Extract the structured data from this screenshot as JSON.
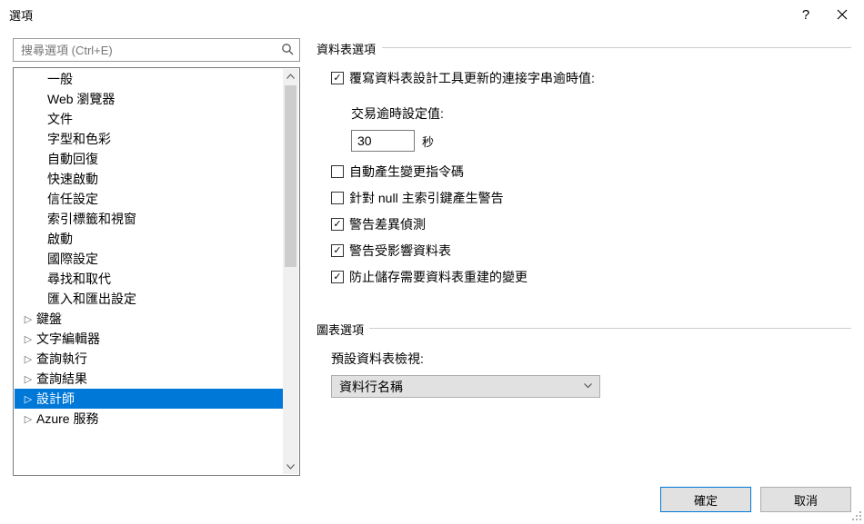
{
  "title": "選項",
  "search_placeholder": "搜尋選項 (Ctrl+E)",
  "tree": {
    "items": [
      {
        "label": "一般",
        "lv": 2
      },
      {
        "label": "Web 瀏覽器",
        "lv": 2
      },
      {
        "label": "文件",
        "lv": 2
      },
      {
        "label": "字型和色彩",
        "lv": 2
      },
      {
        "label": "自動回復",
        "lv": 2
      },
      {
        "label": "快速啟動",
        "lv": 2
      },
      {
        "label": "信任設定",
        "lv": 2
      },
      {
        "label": "索引標籤和視窗",
        "lv": 2
      },
      {
        "label": "啟動",
        "lv": 2
      },
      {
        "label": "國際設定",
        "lv": 2
      },
      {
        "label": "尋找和取代",
        "lv": 2
      },
      {
        "label": "匯入和匯出設定",
        "lv": 2
      },
      {
        "label": "鍵盤",
        "lv": 1,
        "arrow": "▷"
      },
      {
        "label": "文字編輯器",
        "lv": 1,
        "arrow": "▷"
      },
      {
        "label": "查詢執行",
        "lv": 1,
        "arrow": "▷"
      },
      {
        "label": "查詢結果",
        "lv": 1,
        "arrow": "▷"
      },
      {
        "label": "設計師",
        "lv": 1,
        "arrow": "▷",
        "selected": true
      },
      {
        "label": "Azure 服務",
        "lv": 1,
        "arrow": "▷"
      }
    ]
  },
  "group1": {
    "title": "資料表選項",
    "chk_override": {
      "label": "覆寫資料表設計工具更新的連接字串逾時值:",
      "checked": true
    },
    "timeout_label": "交易逾時設定值:",
    "timeout_value": "30",
    "timeout_unit": "秒",
    "chk_script": {
      "label": "自動產生變更指令碼",
      "checked": false
    },
    "chk_null": {
      "label": "針對 null 主索引鍵產生警告",
      "checked": false
    },
    "chk_diff": {
      "label": "警告差異偵測",
      "checked": true
    },
    "chk_affected": {
      "label": "警告受影響資料表",
      "checked": true
    },
    "chk_prevent": {
      "label": "防止儲存需要資料表重建的變更",
      "checked": true
    }
  },
  "group2": {
    "title": "圖表選項",
    "default_view_label": "預設資料表檢視:",
    "default_view_value": "資料行名稱"
  },
  "buttons": {
    "ok": "確定",
    "cancel": "取消"
  }
}
